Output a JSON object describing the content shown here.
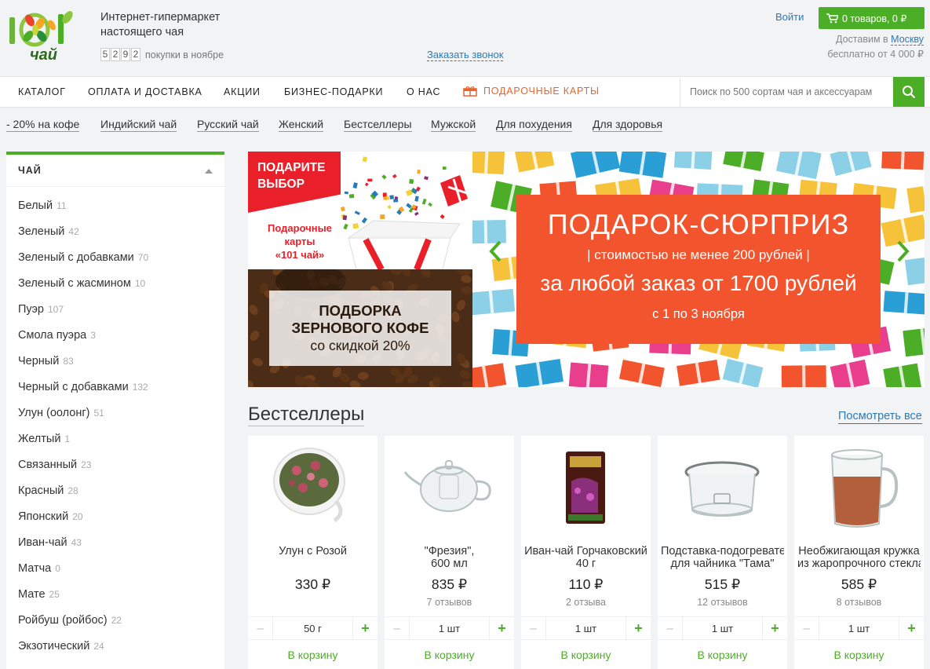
{
  "header": {
    "logo_text": "чай",
    "logo_number": "101",
    "tagline_line1": "Интернет-гипермаркет",
    "tagline_line2": "настоящего чая",
    "counter_digits": [
      "5",
      "2",
      "9",
      "2"
    ],
    "counter_text": "покупки в ноябре",
    "callback_label": "Заказать звонок",
    "login_label": "Войти",
    "cart_label": "0 товаров, 0 ₽",
    "delivery_prefix": "Доставим в",
    "delivery_city": "Москву",
    "delivery_free": "бесплатно от 4 000 ₽"
  },
  "nav": {
    "items": [
      "КАТАЛОГ",
      "ОПЛАТА И ДОСТАВКА",
      "АКЦИИ",
      "БИЗНЕС-ПОДАРКИ",
      "О НАС"
    ],
    "gift_cards_label": "ПОДАРОЧНЫЕ КАРТЫ",
    "search_placeholder": "Поиск по 500 сортам чая и аксессуарам"
  },
  "quick_links": [
    "- 20% на кофе",
    "Индийский чай",
    "Русский чай",
    "Женский",
    "Бестселлеры",
    "Мужской",
    "Для похудения",
    "Для здоровья"
  ],
  "sidebar": {
    "title": "ЧАЙ",
    "items": [
      {
        "label": "Белый",
        "count": "11"
      },
      {
        "label": "Зеленый",
        "count": "42"
      },
      {
        "label": "Зеленый с добавками",
        "count": "70"
      },
      {
        "label": "Зеленый с жасмином",
        "count": "10"
      },
      {
        "label": "Пуэр",
        "count": "107"
      },
      {
        "label": "Смола пуэра",
        "count": "3"
      },
      {
        "label": "Черный",
        "count": "83"
      },
      {
        "label": "Черный с добавками",
        "count": "132"
      },
      {
        "label": "Улун (оолонг)",
        "count": "51"
      },
      {
        "label": "Желтый",
        "count": "1"
      },
      {
        "label": "Связанный",
        "count": "23"
      },
      {
        "label": "Красный",
        "count": "28"
      },
      {
        "label": "Японский",
        "count": "20"
      },
      {
        "label": "Иван-чай",
        "count": "43"
      },
      {
        "label": "Матча",
        "count": "0"
      },
      {
        "label": "Мате",
        "count": "25"
      },
      {
        "label": "Ройбуш (ройбос)",
        "count": "22"
      },
      {
        "label": "Экзотический",
        "count": "24"
      }
    ]
  },
  "promo_gift": {
    "tag_line1": "ПОДАРИТЕ",
    "tag_line2": "ВЫБОР",
    "text_line1": "Подарочные",
    "text_line2": "карты",
    "text_line3": "«101 чай»"
  },
  "promo_coffee": {
    "line1": "ПОДБОРКА",
    "line2": "ЗЕРНОВОГО КОФЕ",
    "line3": "со скидкой 20%"
  },
  "slider": {
    "title": "ПОДАРОК-СЮРПРИЗ",
    "subtitle": "| стоимостью не менее 200 рублей |",
    "main": "за любой заказ от 1700 рублей",
    "date": "с 1 по 3 ноября"
  },
  "bestsellers": {
    "title": "Бестселлеры",
    "see_all": "Посмотреть все",
    "products": [
      {
        "name_line1": "Улун с Розой",
        "name_line2": "",
        "price": "330 ₽",
        "reviews": "",
        "qty": "50 г",
        "cart": "В корзину"
      },
      {
        "name_line1": "\"Фрезия\",",
        "name_line2": "600 мл",
        "price": "835 ₽",
        "reviews": "7 отзывов",
        "qty": "1 шт",
        "cart": "В корзину"
      },
      {
        "name_line1": "Иван-чай Горчаковский",
        "name_line2": "40 г",
        "price": "110 ₽",
        "reviews": "2 отзыва",
        "qty": "1 шт",
        "cart": "В корзину"
      },
      {
        "name_line1": "Подставка-подогреватель",
        "name_line2": "для чайника \"Тама\"",
        "price": "515 ₽",
        "reviews": "12 отзывов",
        "qty": "1 шт",
        "cart": "В корзину"
      },
      {
        "name_line1": "Необжигающая кружка",
        "name_line2": "из жаропрочного стекла",
        "price": "585 ₽",
        "reviews": "8 отзывов",
        "qty": "1 шт",
        "cart": "В корзину"
      }
    ]
  },
  "colors": {
    "accent_green": "#4cae26",
    "link_blue": "#2a7ab8",
    "promo_red": "#e9202a",
    "slider_orange": "#f2542d"
  }
}
